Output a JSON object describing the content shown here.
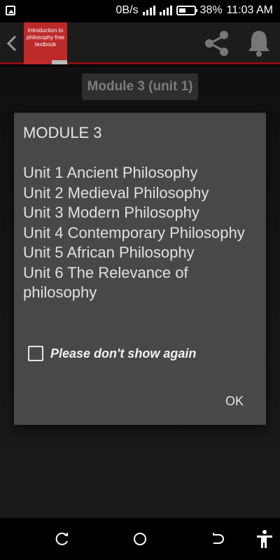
{
  "status_bar": {
    "network_speed": "0B/s",
    "battery_percent": "38%",
    "time": "11:03 AM"
  },
  "app_bar": {
    "book_cover_text": "Introduction to philosophy free textbook",
    "icons": [
      "back-arrow-icon",
      "share-icon",
      "bell-icon"
    ]
  },
  "content": {
    "module_chip_label": "Module 3 (unit 1)"
  },
  "dialog": {
    "title": "MODULE 3",
    "units": [
      "Unit 1 Ancient Philosophy",
      "Unit 2 Medieval Philosophy",
      "Unit 3 Modern Philosophy",
      "Unit 4 Contemporary Philosophy",
      "Unit 5 African Philosophy",
      "Unit 6 The Relevance of philosophy"
    ],
    "checkbox_label": "Please don't show again",
    "checkbox_checked": false,
    "ok_label": "OK"
  },
  "nav_bar": {
    "icons": [
      "recent-apps-icon",
      "home-icon",
      "back-icon",
      "accessibility-icon"
    ]
  },
  "colors": {
    "accent_red": "#8d0d10",
    "book_cover": "#bd2a2a",
    "dialog_bg": "#484848"
  }
}
